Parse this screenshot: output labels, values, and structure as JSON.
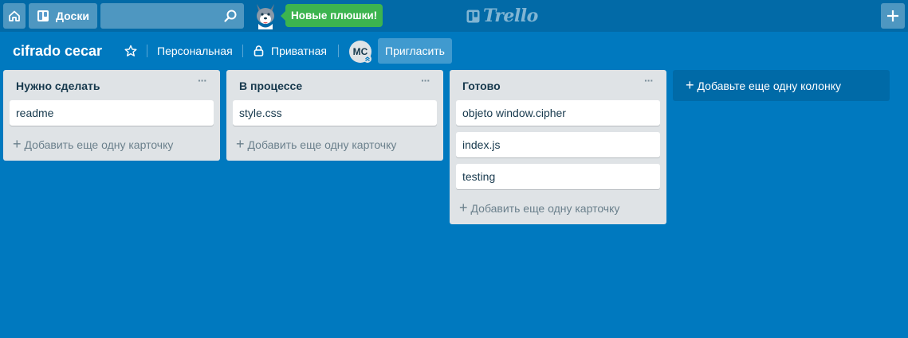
{
  "header": {
    "boards_label": "Доски",
    "search_value": "",
    "promo_label": "Новые плюшки!",
    "logo_text": "Trello"
  },
  "board": {
    "title": "cifrado cecar",
    "team_label": "Персональная",
    "visibility_label": "Приватная",
    "member_initials": "MC",
    "invite_label": "Пригласить"
  },
  "lists": [
    {
      "title": "Нужно сделать",
      "cards": [
        "readme"
      ],
      "add_card_label": "Добавить еще одну карточку"
    },
    {
      "title": "В процессе",
      "cards": [
        "style.css"
      ],
      "add_card_label": "Добавить еще одну карточку"
    },
    {
      "title": "Готово",
      "cards": [
        "objeto window.cipher",
        "index.js",
        "testing"
      ],
      "add_card_label": "Добавить еще одну карточку"
    }
  ],
  "add_list_label": "Добавьте еще одну колонку",
  "colors": {
    "background": "#0079bf",
    "header": "#026aa7",
    "list": "#dfe3e6",
    "promo": "#3cb44f"
  }
}
